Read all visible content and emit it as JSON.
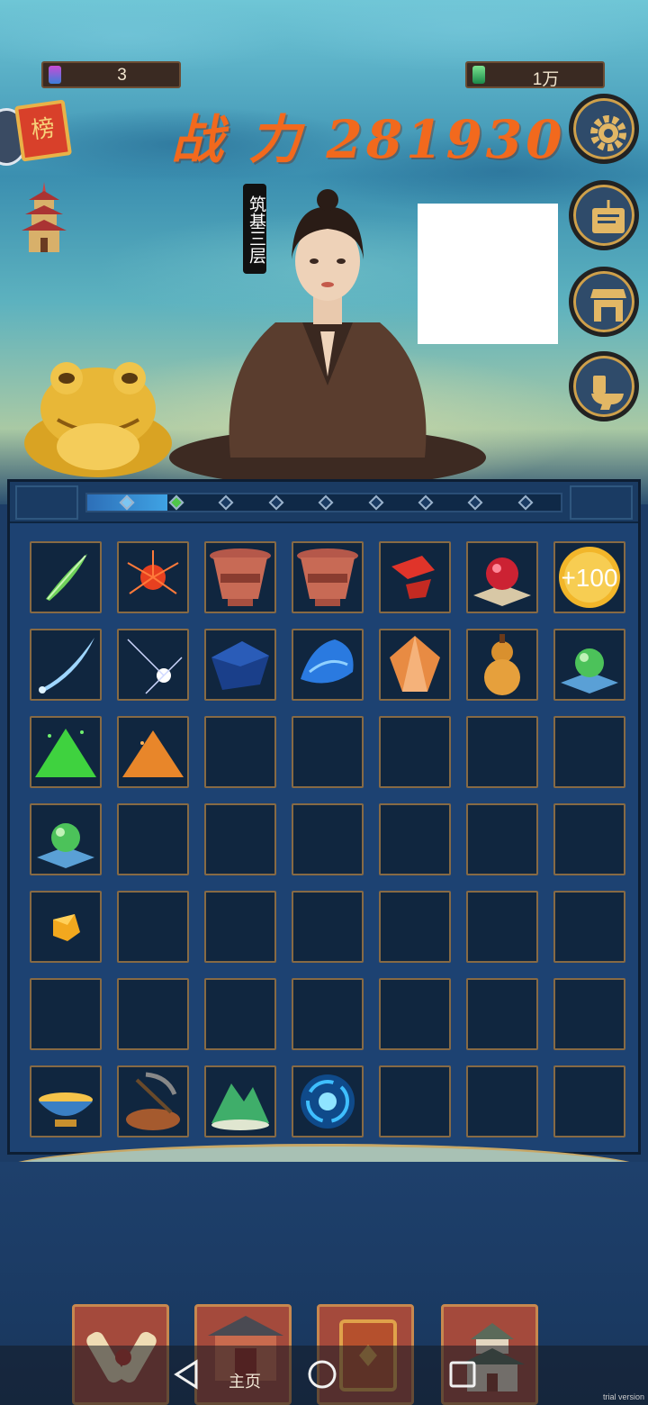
{
  "resources": {
    "left_value": "3",
    "right_value": "1万"
  },
  "power": {
    "text": "战 力 281930"
  },
  "rank_label": "榜",
  "realm_label": "筑基三层",
  "cultivation_progress": {
    "filled_nodes": 2,
    "total_nodes": 9
  },
  "inventory": {
    "rows": [
      [
        "green-feather-icon",
        "red-spider-lily-icon",
        "clay-pot-icon",
        "clay-pot-icon",
        "red-crystal-shard-icon",
        "red-orb-on-cloth-icon",
        "gold-coin-100-icon"
      ],
      [
        "blue-blade-icon",
        "star-sparkle-icon",
        "dark-blue-cloth-icon",
        "blue-silk-cloth-icon",
        "amber-crystal-icon",
        "gourd-icon",
        "green-orb-on-cloth-icon"
      ],
      [
        "green-powder-pile-icon",
        "orange-powder-pile-icon",
        "",
        "",
        "",
        "",
        ""
      ],
      [
        "green-orb-on-cloth-icon",
        "",
        "",
        "",
        "",
        "",
        ""
      ],
      [
        "gold-nugget-icon",
        "",
        "",
        "",
        "",
        "",
        ""
      ],
      [
        "",
        "",
        "",
        "",
        "",
        "",
        ""
      ],
      [
        "treasure-bowl-icon",
        "ore-pickaxe-icon",
        "jade-mountain-icon",
        "blue-vortex-icon",
        "",
        "",
        ""
      ]
    ],
    "coin_label": "+100"
  },
  "bottom_tabs": [
    {
      "name": "scroll-tab",
      "icon": "scroll-icon"
    },
    {
      "name": "home-tab",
      "icon": "gate-icon"
    },
    {
      "name": "book-tab",
      "icon": "book-icon"
    },
    {
      "name": "palace-tab",
      "icon": "palace-icon"
    }
  ],
  "system_nav": {
    "home_label": "主页"
  },
  "watermark": "trial version",
  "colors": {
    "power_text": "#f2691d",
    "panel_bg": "#1d4272",
    "slot_border": "#876a44",
    "tab_bg": "#a44a3c"
  }
}
